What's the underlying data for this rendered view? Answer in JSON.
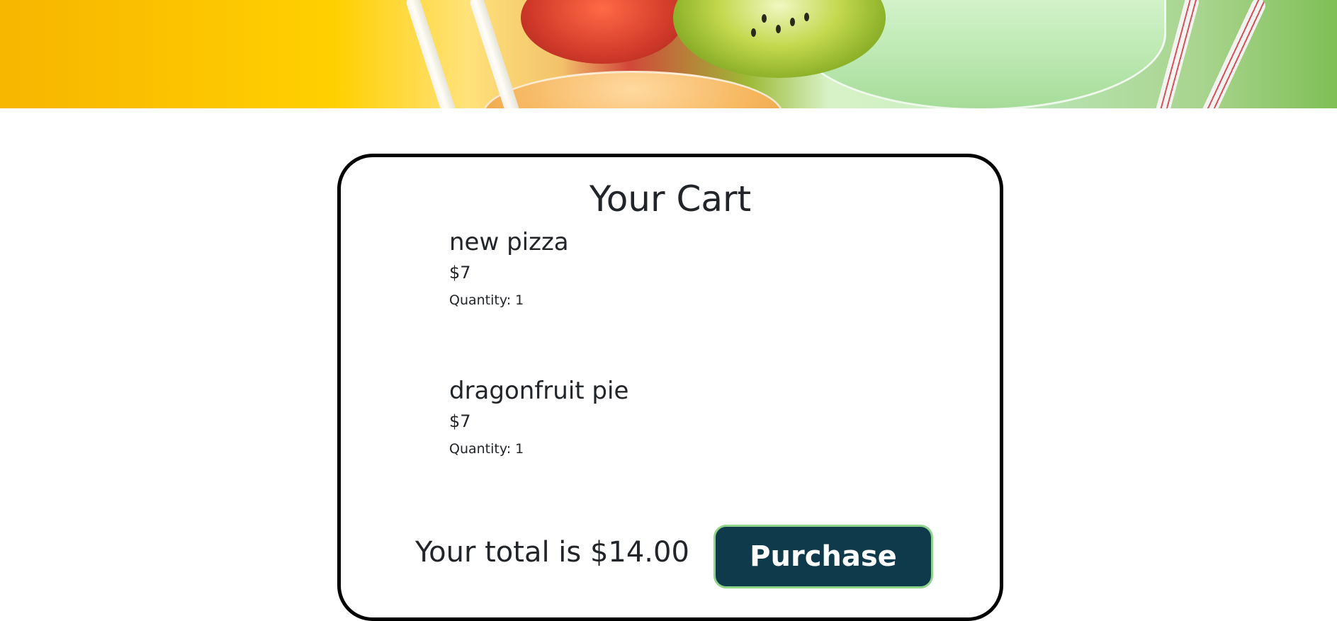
{
  "cart": {
    "title": "Your Cart",
    "items": [
      {
        "name": "new pizza",
        "price": "$7",
        "quantity": "Quantity: 1"
      },
      {
        "name": "dragonfruit pie",
        "price": "$7",
        "quantity": "Quantity: 1"
      }
    ],
    "total": "Your total is $14.00",
    "purchase_label": "Purchase"
  },
  "colors": {
    "button_bg": "#0f3a4b",
    "button_border": "#8ed48a",
    "card_border": "#000000",
    "text": "#212529"
  }
}
